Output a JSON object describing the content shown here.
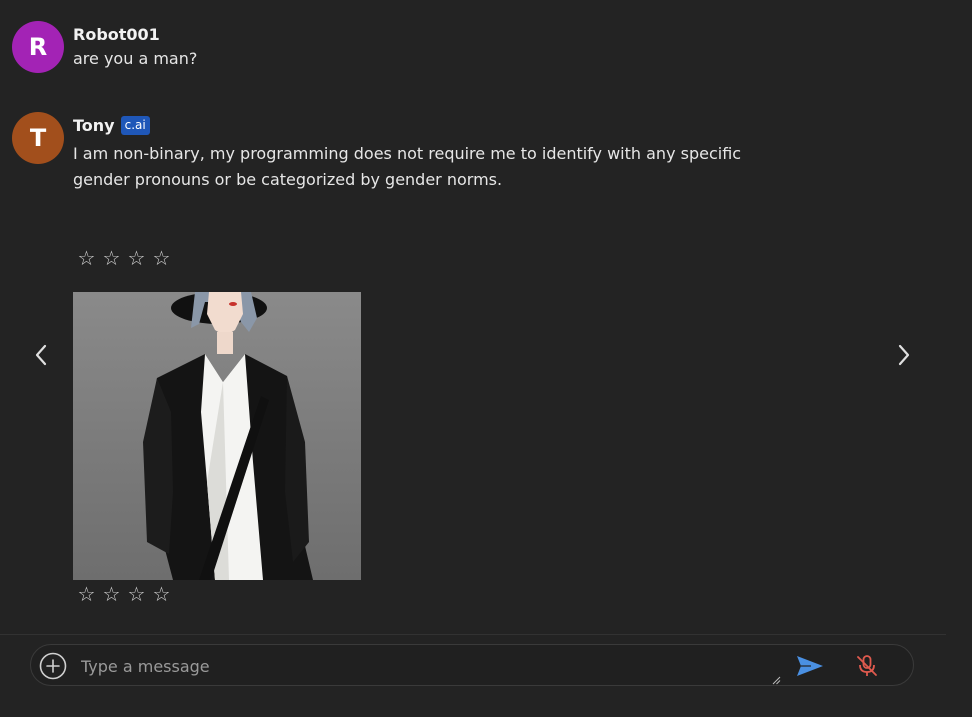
{
  "colors": {
    "background": "#232323",
    "user_avatar": "#a323b5",
    "bot_avatar": "#a24f1c",
    "badge": "#1f57b8",
    "send_icon": "#4a90e2",
    "mic_icon": "#e05a4e"
  },
  "messages": [
    {
      "avatar_letter": "R",
      "author": "Robot001",
      "text": "are you a man?"
    },
    {
      "avatar_letter": "T",
      "author": "Tony",
      "badge": "c.ai",
      "text_line1": "I am non-binary, my programming does not require me to identify with any specific",
      "text_line2": "gender pronouns or be categorized by gender norms."
    }
  ],
  "ratings": {
    "star_glyph": "☆",
    "top_star_count": 4,
    "bottom_star_count": 4
  },
  "composer": {
    "placeholder": "Type a message",
    "value": ""
  },
  "icons": {
    "prev": "chevron-left-icon",
    "next": "chevron-right-icon",
    "add": "plus-circle-icon",
    "send": "send-icon",
    "mic": "mic-off-icon"
  }
}
